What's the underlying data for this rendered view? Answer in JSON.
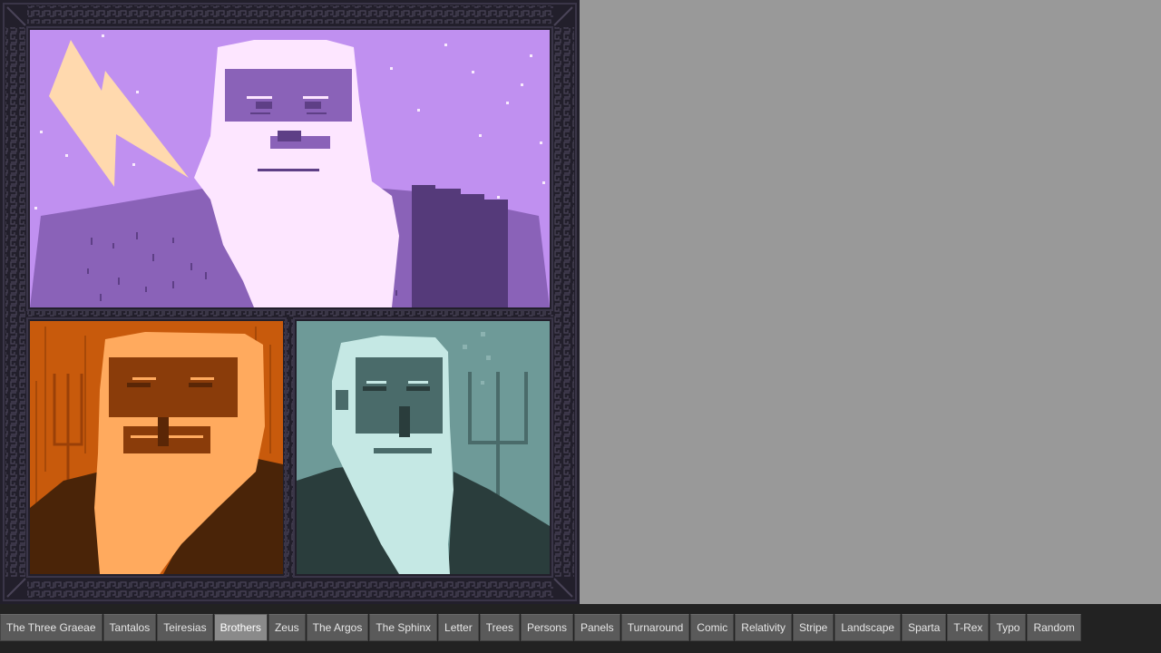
{
  "toolbar": {
    "active": "Brothers",
    "buttons": [
      "The Three Graeae",
      "Tantalos",
      "Teiresias",
      "Brothers",
      "Zeus",
      "The Argos",
      "The Sphinx",
      "Letter",
      "Trees",
      "Persons",
      "Panels",
      "Turnaround",
      "Comic",
      "Relativity",
      "Stripe",
      "Landscape",
      "Sparta",
      "T-Rex",
      "Typo",
      "Random"
    ]
  },
  "colors": {
    "page_bg": "#999999",
    "frame": "#221f2b",
    "meander": "#4a4458",
    "zeus_sky": "#c090f0",
    "zeus_beard": "#fde6ff",
    "zeus_face": "#8a62b8",
    "zeus_bolt": "#ffd9ae",
    "hades_bg": "#c85a0c",
    "hades_beard": "#ffaa5e",
    "hades_face": "#8a3c0a",
    "poseidon_bg": "#6e9a98",
    "poseidon_beard": "#c5e8e4",
    "poseidon_face": "#4a6b6a"
  },
  "panels": [
    {
      "name": "zeus",
      "icons": [
        "lightning-bolt",
        "bearded-face",
        "stone-block"
      ]
    },
    {
      "name": "hades",
      "icons": [
        "pitchfork",
        "bearded-face"
      ]
    },
    {
      "name": "poseidon",
      "icons": [
        "trident",
        "bearded-face"
      ]
    }
  ]
}
